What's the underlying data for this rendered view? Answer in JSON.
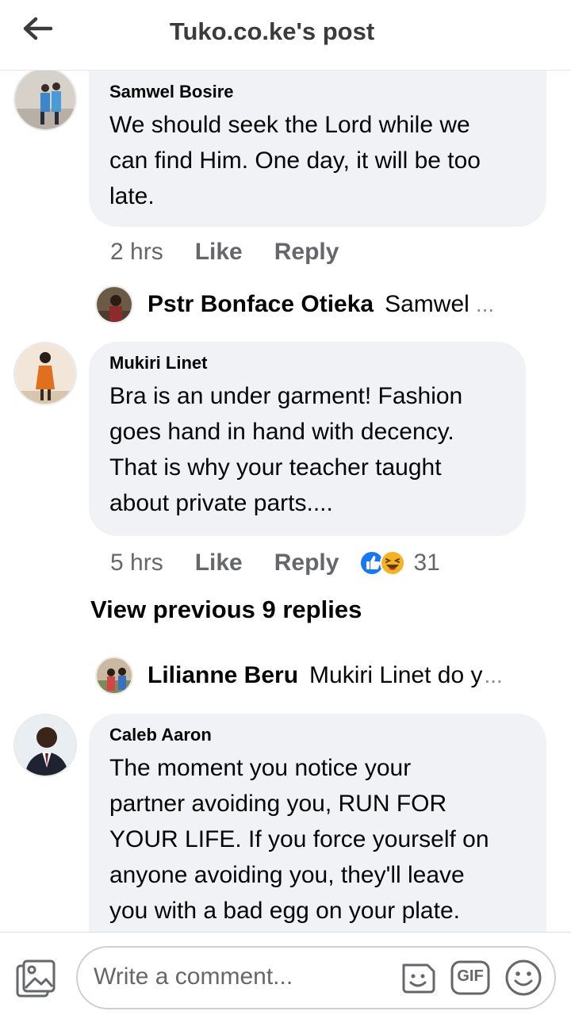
{
  "header": {
    "title": "Tuko.co.ke's post"
  },
  "comments": [
    {
      "author": "Samwel Bosire",
      "lines": [
        "We should seek the Lord while we",
        "can find Him. One day, it will be too",
        "late."
      ],
      "time": "2 hrs",
      "like": "Like",
      "reply": "Reply"
    },
    {
      "author": "Mukiri Linet",
      "lines": [
        "Bra is an under garment! Fashion",
        "goes hand in hand with decency.",
        "That is why your teacher taught",
        "about private parts...."
      ],
      "time": "5 hrs",
      "like": "Like",
      "reply": "Reply",
      "reaction_count": "31",
      "reaction_icons": [
        "like-reaction-icon",
        "haha-reaction-icon"
      ]
    },
    {
      "author": "Caleb Aaron",
      "lines": [
        "The moment you notice your",
        "partner avoiding you, RUN FOR",
        "YOUR LIFE. If you force yourself on",
        "anyone avoiding you, they'll leave",
        "you with a bad egg on your plate."
      ]
    }
  ],
  "replies": [
    {
      "name": "Pstr Bonface Otieka",
      "text": "Samwel",
      "ellipsis": "..."
    },
    {
      "name": "Lilianne Beru",
      "text": "Mukiri Linet do y",
      "ellipsis": "..."
    }
  ],
  "view_previous": "View previous 9 replies",
  "composer": {
    "placeholder": "Write a comment...",
    "gif_label": "GIF",
    "icons": [
      "photo-icon",
      "sticker-icon",
      "gif-icon",
      "emoji-icon"
    ]
  },
  "colors": {
    "bubble": "#f0f2f5",
    "meta_text": "#65676b",
    "like_blue": "#1877f2",
    "haha_yellow": "#f7b125"
  }
}
